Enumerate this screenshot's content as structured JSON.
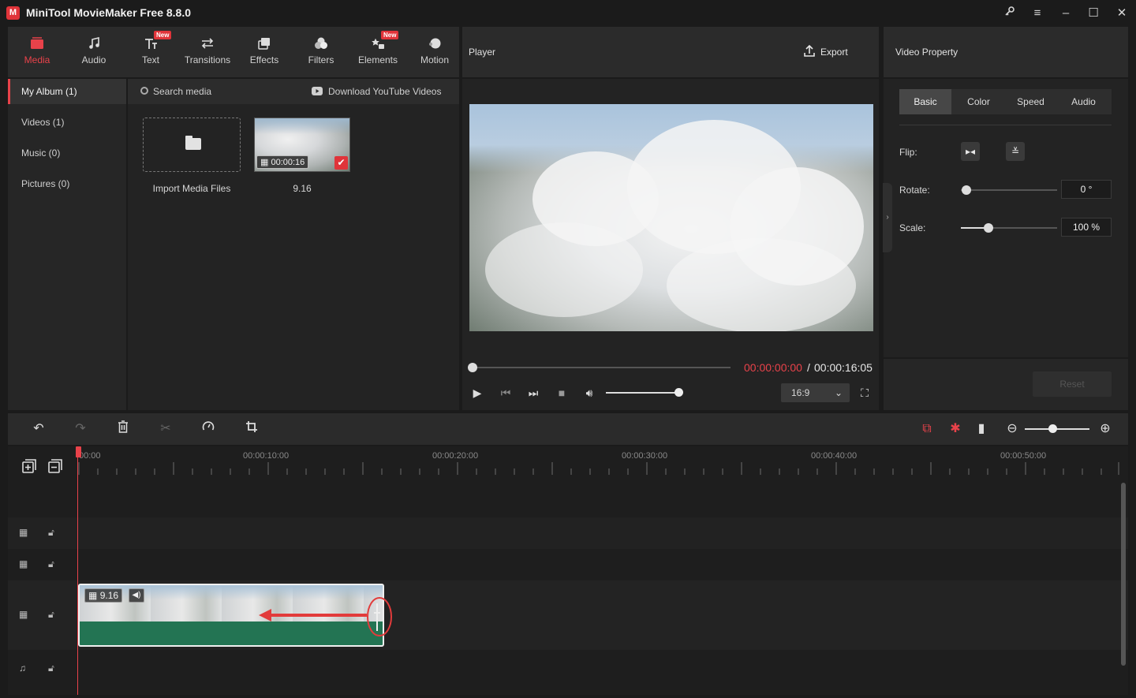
{
  "app": {
    "title": "MiniTool MovieMaker Free 8.8.0",
    "logo": "M"
  },
  "window_controls": [
    "key-icon",
    "menu-icon",
    "minimize-icon",
    "maximize-icon",
    "close-icon"
  ],
  "toolbar": {
    "tabs": [
      {
        "label": "Media",
        "active": true,
        "icon": "media-icon"
      },
      {
        "label": "Audio",
        "icon": "audio-icon"
      },
      {
        "label": "Text",
        "badge": "New",
        "icon": "text-icon"
      },
      {
        "label": "Transitions",
        "icon": "transitions-icon"
      },
      {
        "label": "Effects",
        "icon": "effects-icon"
      },
      {
        "label": "Filters",
        "icon": "filters-icon"
      },
      {
        "label": "Elements",
        "badge": "New",
        "icon": "elements-icon"
      },
      {
        "label": "Motion",
        "icon": "motion-icon"
      }
    ]
  },
  "album": {
    "items": [
      {
        "label": "My Album (1)",
        "active": true
      },
      {
        "label": "Videos (1)"
      },
      {
        "label": "Music (0)"
      },
      {
        "label": "Pictures (0)"
      }
    ]
  },
  "media": {
    "search_placeholder": "Search media",
    "download_label": "Download YouTube Videos",
    "import_label": "Import Media Files",
    "clip": {
      "duration": "00:00:16",
      "name": "9.16"
    }
  },
  "player": {
    "title": "Player",
    "export_label": "Export",
    "time_current": "00:00:00:00",
    "time_separator": "/",
    "time_total": "00:00:16:05",
    "aspect_ratio": "16:9",
    "progress": 0,
    "volume": 1.0
  },
  "properties": {
    "title": "Video Property",
    "tabs": [
      "Basic",
      "Color",
      "Speed",
      "Audio"
    ],
    "active_tab": "Basic",
    "flip_label": "Flip:",
    "rotate_label": "Rotate:",
    "rotate_value": "0 °",
    "scale_label": "Scale:",
    "scale_value": "100 %",
    "reset_label": "Reset"
  },
  "timeline": {
    "ticks": [
      "00:00",
      "00:00:10:00",
      "00:00:20:00",
      "00:00:30:00",
      "00:00:40:00",
      "00:00:50:00"
    ],
    "clip_name": "9.16"
  },
  "colors": {
    "accent": "#e8424a",
    "clip_green": "#237453"
  }
}
